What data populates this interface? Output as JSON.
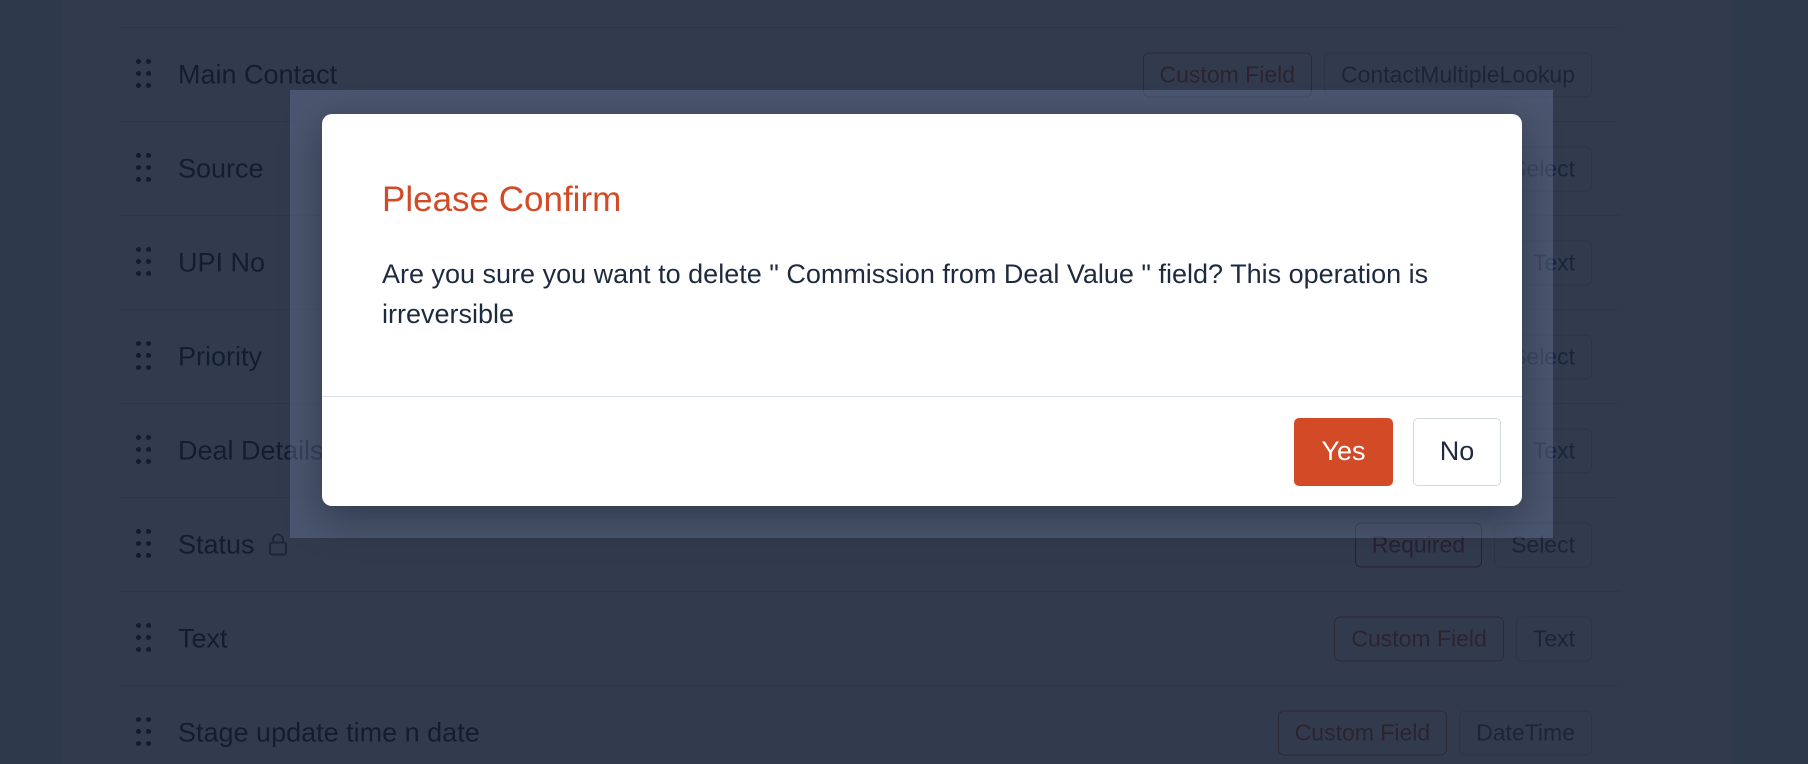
{
  "fields": [
    {
      "name": "",
      "badges": [
        {
          "label": "",
          "kind": "required"
        },
        {
          "label": "",
          "kind": "plain"
        }
      ]
    },
    {
      "name": "Main Contact",
      "badges": [
        {
          "label": "Custom Field",
          "kind": "custom"
        },
        {
          "label": "ContactMultipleLookup",
          "kind": "plain"
        }
      ]
    },
    {
      "name": "Source",
      "badges": [
        {
          "label": "Select",
          "kind": "plain"
        }
      ]
    },
    {
      "name": "UPI No",
      "badges": [
        {
          "label": "Text",
          "kind": "plain"
        }
      ]
    },
    {
      "name": "Priority",
      "badges": [
        {
          "label": "Select",
          "kind": "plain"
        }
      ]
    },
    {
      "name": "Deal Details",
      "badges": [
        {
          "label": "Text",
          "kind": "plain"
        }
      ]
    },
    {
      "name": "Status",
      "locked": true,
      "badges": [
        {
          "label": "Required",
          "kind": "required"
        },
        {
          "label": "Select",
          "kind": "plain"
        }
      ]
    },
    {
      "name": "Text",
      "badges": [
        {
          "label": "Custom Field",
          "kind": "custom"
        },
        {
          "label": "Text",
          "kind": "plain"
        }
      ]
    },
    {
      "name": "Stage update time n date",
      "badges": [
        {
          "label": "Custom Field",
          "kind": "custom"
        },
        {
          "label": "DateTime",
          "kind": "plain"
        }
      ]
    }
  ],
  "modal": {
    "title": "Please Confirm",
    "message": "Are you sure you want to delete \" Commission from Deal Value \" field? This operation is irreversible",
    "yes_label": "Yes",
    "no_label": "No"
  },
  "colors": {
    "accent": "#d24a26",
    "overlay": "#1b2840"
  }
}
